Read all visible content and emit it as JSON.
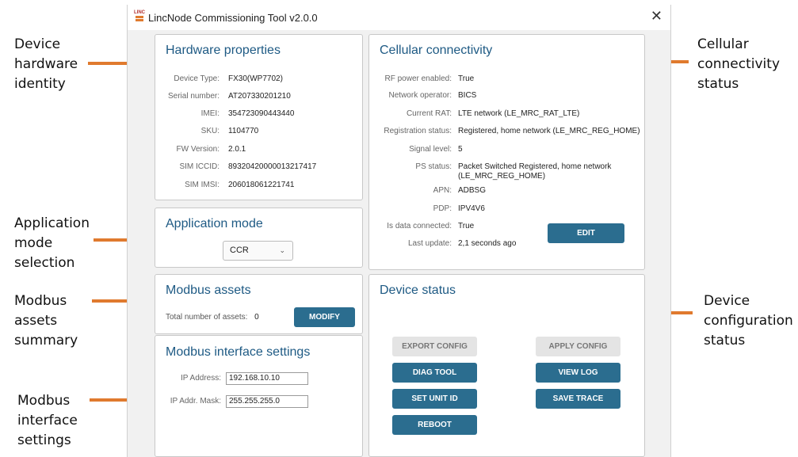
{
  "window": {
    "title": "LincNode Commissioning Tool v2.0.0",
    "logo_text": "LINC"
  },
  "annotations": {
    "device_hardware_identity": [
      "Device",
      "hardware",
      "identity"
    ],
    "application_mode_selection": [
      "Application",
      "mode",
      "selection"
    ],
    "modbus_assets_summary": [
      "Modbus",
      "assets",
      "summary"
    ],
    "modbus_interface_settings": [
      "Modbus",
      "interface",
      "settings"
    ],
    "cellular_connectivity_status": [
      "Cellular",
      "connectivity",
      "status"
    ],
    "device_configuration_status": [
      "Device",
      "configuration",
      "status"
    ],
    "arrow_color": "#e07a2e"
  },
  "hardware": {
    "title": "Hardware properties",
    "rows": [
      {
        "label": "Device Type:",
        "value": "FX30(WP7702)"
      },
      {
        "label": "Serial number:",
        "value": "AT207330201210"
      },
      {
        "label": "IMEI:",
        "value": "354723090443440"
      },
      {
        "label": "SKU:",
        "value": "1104770"
      },
      {
        "label": "FW Version:",
        "value": "2.0.1"
      },
      {
        "label": "SIM ICCID:",
        "value": "89320420000013217417"
      },
      {
        "label": "SIM IMSI:",
        "value": "206018061221741"
      }
    ]
  },
  "app_mode": {
    "title": "Application mode",
    "selected": "CCR"
  },
  "modbus_assets": {
    "title": "Modbus assets",
    "total_label": "Total number of assets:",
    "total_value": "0",
    "modify_label": "MODIFY"
  },
  "modbus_interface": {
    "title": "Modbus interface settings",
    "ip_label": "IP Address:",
    "ip_value": "192.168.10.10",
    "mask_label": "IP Addr. Mask:",
    "mask_value": "255.255.255.0"
  },
  "cellular": {
    "title": "Cellular connectivity",
    "rows": [
      {
        "label": "RF power enabled:",
        "value": "True"
      },
      {
        "label": "Network operator:",
        "value": "BICS"
      },
      {
        "label": "Current RAT:",
        "value": "LTE network (LE_MRC_RAT_LTE)"
      },
      {
        "label": "Registration status:",
        "value": "Registered, home network (LE_MRC_REG_HOME)"
      },
      {
        "label": "Signal level:",
        "value": "5"
      },
      {
        "label": "PS status:",
        "value": "Packet Switched Registered, home network",
        "value2": "(LE_MRC_REG_HOME)"
      },
      {
        "label": "APN:",
        "value": "ADBSG"
      },
      {
        "label": "PDP:",
        "value": "IPV4V6"
      },
      {
        "label": "Is data connected:",
        "value": "True"
      },
      {
        "label": "Last update:",
        "value": "2,1 seconds ago"
      }
    ],
    "edit_label": "EDIT"
  },
  "device_status": {
    "title": "Device status",
    "export_config": "EXPORT CONFIG",
    "apply_config": "APPLY CONFIG",
    "diag_tool": "DIAG TOOL",
    "view_log": "VIEW LOG",
    "set_unit_id": "SET UNIT ID",
    "save_trace": "SAVE TRACE",
    "reboot": "REBOOT"
  },
  "colors": {
    "accent": "#2b6d8f",
    "heading": "#1e5a84",
    "disabled": "#e4e4e4"
  }
}
